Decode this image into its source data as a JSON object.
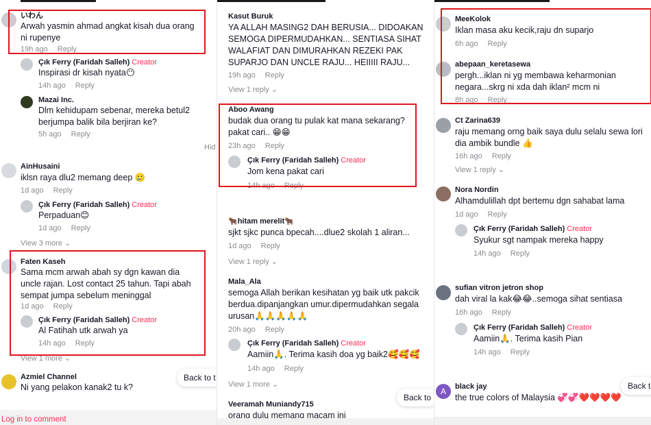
{
  "labels": {
    "reply": "Reply",
    "creator": "Creator",
    "hide": "Hid",
    "back_to": "Back to",
    "back_t": "Back to t",
    "login": "Log in to comment"
  },
  "col1": {
    "c1": {
      "name": "いわん",
      "text": "Arwah yasmin ahmad angkat kisah dua orang ni rupenye",
      "time": "19h ago"
    },
    "r1": {
      "name": "Çık Ferry (Faridah Salleh)",
      "text": "Inspirasi dr kisah nyata😶",
      "time": "14h ago"
    },
    "r2": {
      "name": "Mazai Inc.",
      "text": "Dlm kehidupam sebenar, mereka betul2 berjumpa balik bila berjiran ke?",
      "time": "5h ago"
    },
    "c2": {
      "name": "AinHusaini",
      "text": "iklsn raya dlu2 memang deep 🥲",
      "time": "1d ago"
    },
    "r3": {
      "name": "Çık Ferry (Faridah Salleh)",
      "text": "Perpaduan😊",
      "time": "1d ago"
    },
    "view1": "View 3 more",
    "c3": {
      "name": "Faten Kaseh",
      "text": "Sama mcm arwah abah sy dgn kawan dia uncle rajan. Lost contact 25 tahun. Tapi abah sempat jumpa sebelum meninggal",
      "time": "1d ago"
    },
    "r4": {
      "name": "Çık Ferry (Faridah Salleh)",
      "text": "Al Fatihah utk arwah ya",
      "time": "14h ago"
    },
    "view2": "View 1 more",
    "c4": {
      "name": "Azmiel Channel",
      "text": "Ni yang pelakon kanak2 tu k?"
    }
  },
  "col2": {
    "c1": {
      "name": "Kasut Buruk",
      "text": "YA ALLAH MASING2 DAH BERUSIA... DIDOAKAN SEMOGA DIPERMUDAHKAN... SENTIASA SIHAT WALAFIAT DAN DIMURAHKAN REZEKI PAK SUPARJO DAN UNCLE RAJU... HEIIIII RAJU...",
      "time": "19h ago"
    },
    "view1": "View 1 reply",
    "c2": {
      "name": "Aboo Awang",
      "text": "budak dua orang tu pulak kat mana sekarang? pakat cari.. 😁😁",
      "time": "23h ago"
    },
    "r1": {
      "name": "Çık Ferry (Faridah Salleh)",
      "text": "Jom kena pakat cari",
      "time": "14h ago"
    },
    "c3": {
      "name": "🐂hitam merelit🐂",
      "text": "sjkt sjkc punca bpecah....dlue2 skolah 1 aliran...",
      "time": "1d ago"
    },
    "view2": "View 1 reply",
    "c4": {
      "name": "Mala_Ala",
      "text": "semoga Allah berikan kesihatan yg baik utk pakcik berdua.dipanjangkan umur.dipermudahkan segala urusan🙏🙏🙏🙏🙏",
      "time": "20h ago"
    },
    "r2": {
      "name": "Çık Ferry (Faridah Salleh)",
      "text": "Aamiin🙏. Terima kasih doa yg baik2🥰🥰🥰",
      "time": "14h ago"
    },
    "view3": "View 1 more",
    "c5": {
      "name": "Veeramah Muniandy715",
      "text": "orang dulu memang macam ini"
    }
  },
  "col3": {
    "c1": {
      "name": "MeeKolok",
      "text": "Iklan masa aku kecik,raju dn suparjo",
      "time": "6h ago"
    },
    "c2": {
      "name": "abepaan_keretasewa",
      "text": "pergh...iklan ni yg membawa keharmonian negara...skrg ni xda dah iklan² mcm ni",
      "time": "8h ago"
    },
    "c3": {
      "name": "Ct Zarina639",
      "text": "raju memang orng baik saya dulu selalu sewa lori dia ambik bundle 👍",
      "time": "16h ago"
    },
    "view1": "View 1 reply",
    "c4": {
      "name": "Nora Nordin",
      "text": "Alhamdulillah dpt bertemu dgn sahabat lama",
      "time": "1d ago"
    },
    "r1": {
      "name": "Çık Ferry (Faridah Salleh)",
      "text": "Syukur sgt nampak mereka happy",
      "time": "14h ago"
    },
    "c5": {
      "name": "sufian vitron jetron shop",
      "text": "dah viral la kak😂😂..semoga sihat sentiasa",
      "time": "16h ago"
    },
    "r2": {
      "name": "Çık Ferry (Faridah Salleh)",
      "text": "Aamiin🙏. Terima kasih Pian",
      "time": "14h ago"
    },
    "c6": {
      "name": "black jay",
      "avatar_letter": "A",
      "text": "the true colors of Malaysia 💞💞❤️❤️❤️❤️"
    }
  },
  "colors": {
    "accent": "#fe2c55",
    "highlight_box": "#e0141e",
    "muted": "#8a8b91"
  },
  "icons": {
    "chevron": "chevron-down-icon"
  }
}
